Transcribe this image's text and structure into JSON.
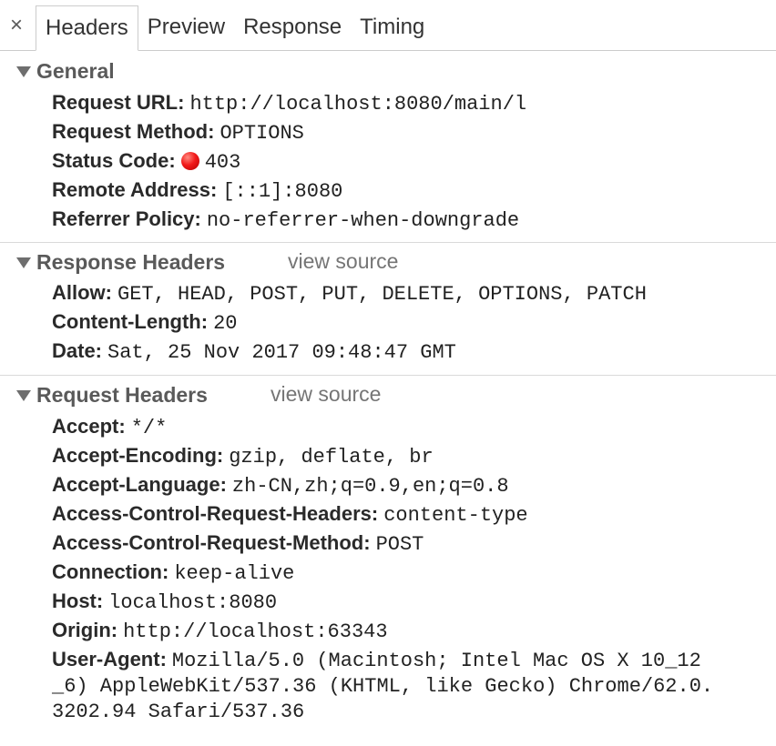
{
  "tabs": {
    "close_label": "×",
    "items": [
      {
        "label": "Headers"
      },
      {
        "label": "Preview"
      },
      {
        "label": "Response"
      },
      {
        "label": "Timing"
      }
    ]
  },
  "general": {
    "title": "General",
    "request_url_name": "Request URL:",
    "request_url_value": "http://localhost:8080/main/l",
    "request_method_name": "Request Method:",
    "request_method_value": "OPTIONS",
    "status_code_name": "Status Code:",
    "status_code_value": "403",
    "status_color": "#e81b1b",
    "remote_address_name": "Remote Address:",
    "remote_address_value": "[::1]:8080",
    "referrer_policy_name": "Referrer Policy:",
    "referrer_policy_value": "no-referrer-when-downgrade"
  },
  "response_headers": {
    "title": "Response Headers",
    "view_source": "view source",
    "allow_name": "Allow:",
    "allow_value": "GET, HEAD, POST, PUT, DELETE, OPTIONS, PATCH",
    "content_length_name": "Content-Length:",
    "content_length_value": "20",
    "date_name": "Date:",
    "date_value": "Sat, 25 Nov 2017 09:48:47 GMT"
  },
  "request_headers": {
    "title": "Request Headers",
    "view_source": "view source",
    "accept_name": "Accept:",
    "accept_value": "*/*",
    "accept_encoding_name": "Accept-Encoding:",
    "accept_encoding_value": "gzip, deflate, br",
    "accept_language_name": "Accept-Language:",
    "accept_language_value": "zh-CN,zh;q=0.9,en;q=0.8",
    "acrh_name": "Access-Control-Request-Headers:",
    "acrh_value": "content-type",
    "acrm_name": "Access-Control-Request-Method:",
    "acrm_value": "POST",
    "connection_name": "Connection:",
    "connection_value": "keep-alive",
    "host_name": "Host:",
    "host_value": "localhost:8080",
    "origin_name": "Origin:",
    "origin_value": "http://localhost:63343",
    "user_agent_name": "User-Agent:",
    "user_agent_line1": "Mozilla/5.0 (Macintosh; Intel Mac OS X 10_12",
    "user_agent_line2": "_6) AppleWebKit/537.36 (KHTML, like Gecko) Chrome/62.0.",
    "user_agent_line3": "3202.94 Safari/537.36"
  }
}
